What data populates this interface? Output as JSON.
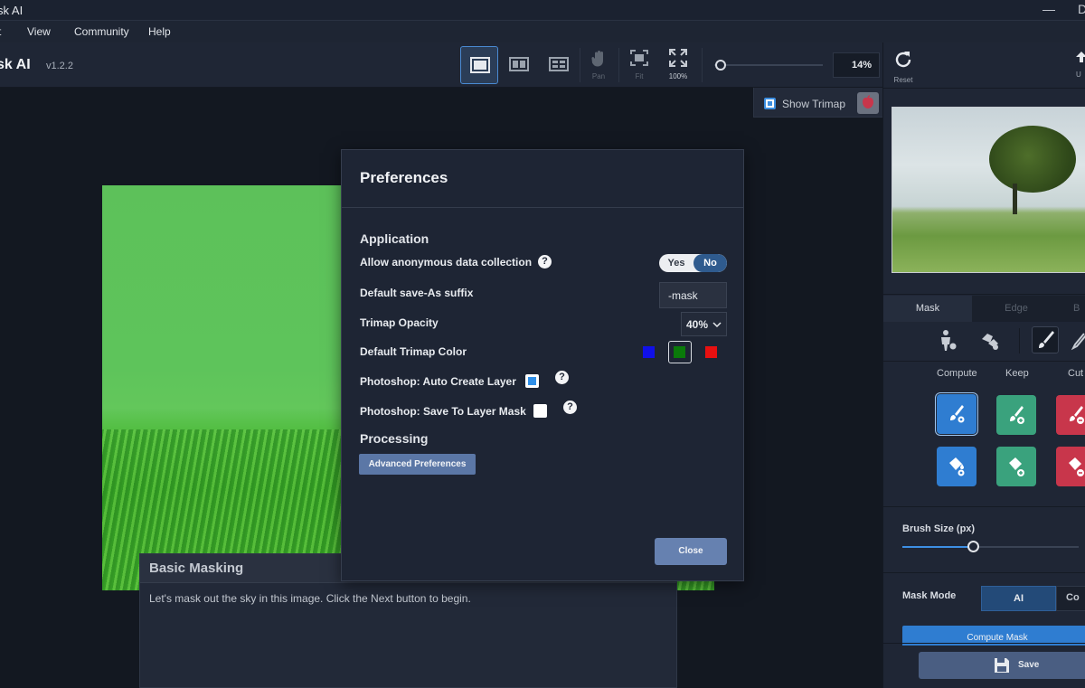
{
  "window": {
    "title": "sk AI",
    "controls": [
      "—",
      "D"
    ]
  },
  "menu": [
    "t",
    "View",
    "Community",
    "Help"
  ],
  "toolbar": {
    "app_name": "sk AI",
    "version": "v1.2.2",
    "tools": {
      "pan": "Pan",
      "fit": "Fit",
      "full": "100%"
    },
    "zoom": "14%"
  },
  "canvas": {
    "show_trimap": "Show Trimap"
  },
  "tutorial": {
    "title": "Basic Masking",
    "text": "Let's mask out the sky in this image. Click the Next button to begin."
  },
  "preferences": {
    "title": "Preferences",
    "application_heading": "Application",
    "rows": {
      "data_collection": "Allow anonymous data collection",
      "save_suffix": "Default save-As suffix",
      "trimap_opacity": "Trimap Opacity",
      "trimap_color": "Default Trimap Color",
      "auto_layer": "Photoshop: Auto Create Layer",
      "layer_mask": "Photoshop: Save To Layer Mask"
    },
    "toggle": {
      "yes": "Yes",
      "no": "No",
      "selected": "No"
    },
    "suffix_value": "-mask",
    "opacity_value": "40%",
    "help_glyph": "?",
    "trimap_colors": [
      "#1010e8",
      "#0a7a0a",
      "#e81010"
    ],
    "auto_layer_checked": true,
    "layer_mask_checked": false,
    "processing_heading": "Processing",
    "advanced_button": "Advanced Preferences",
    "close_button": "Close"
  },
  "right_panel": {
    "reset_label": "Reset",
    "upper_right_label": "U",
    "tabs": [
      "Mask",
      "Edge",
      "B"
    ],
    "columns": [
      "Compute",
      "Keep",
      "Cut"
    ],
    "brush_size_label": "Brush Size (px)",
    "brush_size_fraction": 0.4,
    "mask_mode_label": "Mask Mode",
    "mask_mode_ai": "AI",
    "mask_mode_other": "Co",
    "compute_button": "Compute Mask",
    "save_button": "Save"
  },
  "colors": {
    "accent": "#2f7dd1",
    "keep": "#3aa27d",
    "cut": "#c8364b",
    "dialog_bg": "#1e2534"
  }
}
